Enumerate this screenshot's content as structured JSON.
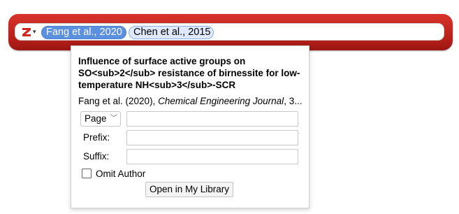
{
  "quick_format": {
    "citations": [
      {
        "label": "Fang et al., 2020",
        "selected": true
      },
      {
        "label": "Chen et al., 2015",
        "selected": false
      }
    ],
    "logo_icon": "zotero-z-icon",
    "menu_icon": "caret-down-icon",
    "bar_color": "#c62a24"
  },
  "popup": {
    "title": "Influence of surface active groups on SO<sub>2</sub> resistance of birnessite for low-temperature NH<sub>3</sub>-SCR",
    "meta_prefix": "Fang et al. (2020), ",
    "meta_journal": "Chemical Engineering Journal",
    "meta_suffix": ", 3...",
    "locator_type": "Page",
    "locator_value": "",
    "prefix_label": "Prefix:",
    "prefix_value": "",
    "suffix_label": "Suffix:",
    "suffix_value": "",
    "omit_author_label": "Omit Author",
    "omit_author_checked": false,
    "open_button_label": "Open in My Library"
  }
}
